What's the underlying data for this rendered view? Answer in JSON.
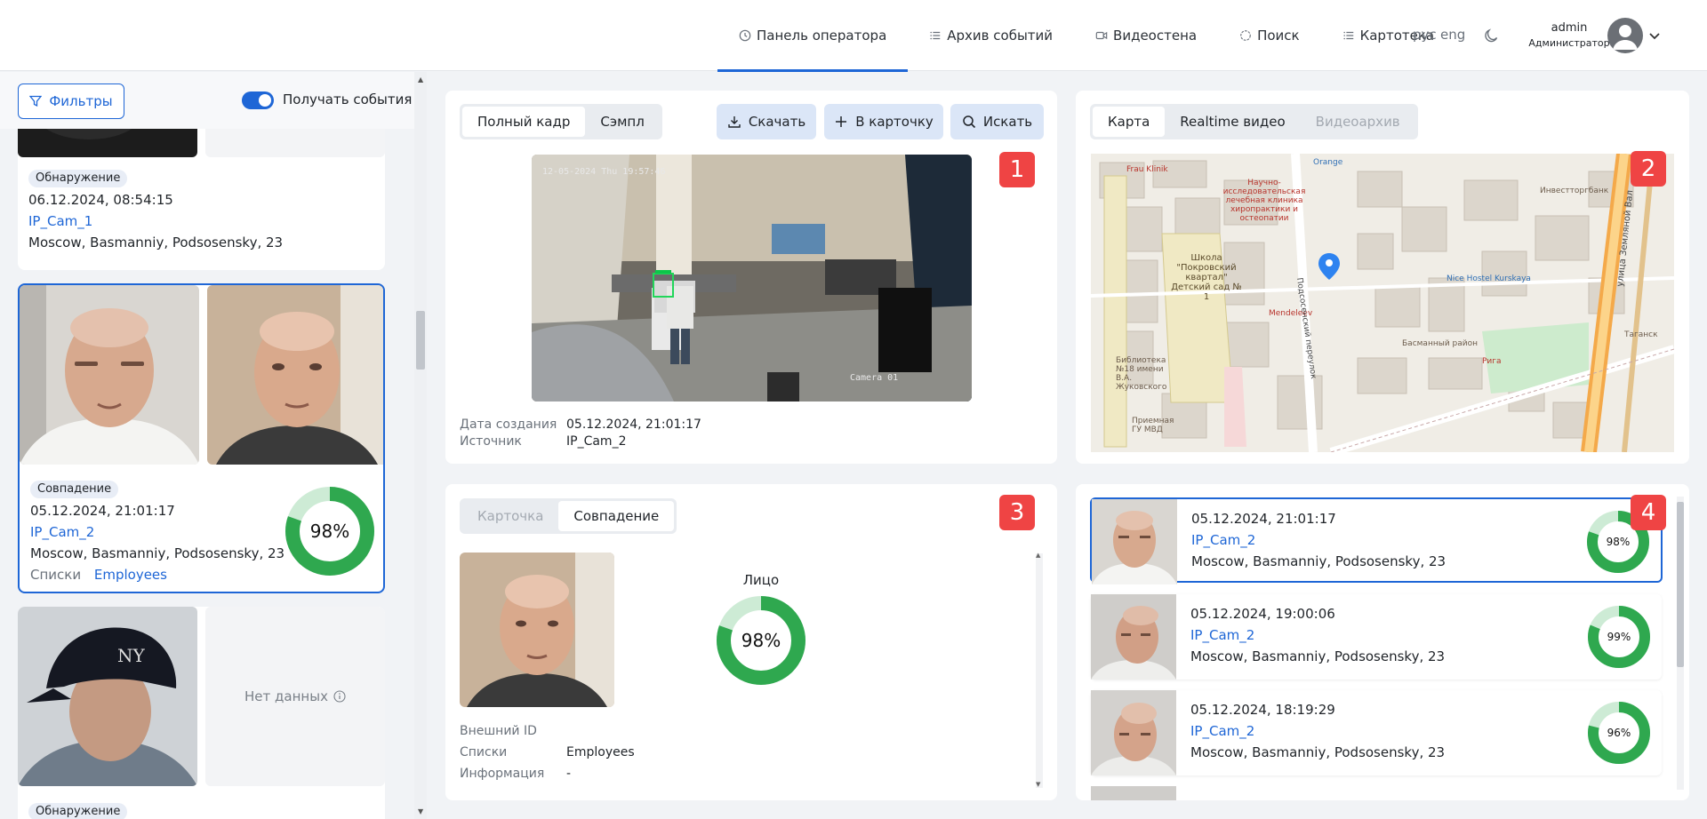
{
  "nav": {
    "items": [
      {
        "label": "Панель оператора",
        "icon": "clock-icon",
        "active": true
      },
      {
        "label": "Архив событий",
        "icon": "list-icon",
        "active": false
      },
      {
        "label": "Видеостена",
        "icon": "video-icon",
        "active": false
      },
      {
        "label": "Поиск",
        "icon": "search-circle-icon",
        "active": false
      },
      {
        "label": "Картотека",
        "icon": "list-icon",
        "active": false
      }
    ],
    "lang_ru": "рус",
    "lang_en": "eng",
    "user_name": "admin",
    "user_role": "Администратор"
  },
  "sidebar": {
    "filters_label": "Фильтры",
    "toggle_label": "Получать события",
    "events": [
      {
        "tag": "Обнаружение",
        "datetime": "06.12.2024, 08:54:15",
        "camera": "IP_Cam_1",
        "location": "Moscow, Basmanniy, Podsosensky, 23"
      },
      {
        "tag": "Совпадение",
        "datetime": "05.12.2024, 21:01:17",
        "camera": "IP_Cam_2",
        "location": "Moscow, Basmanniy, Podsosensky, 23",
        "lists_label": "Списки",
        "lists_value": "Employees",
        "score": "98%",
        "score_value": 98
      },
      {
        "tag": "Обнаружение",
        "nodata": "Нет данных"
      }
    ]
  },
  "frame_panel": {
    "tabs": [
      "Полный кадр",
      "Сэмпл"
    ],
    "download_label": "Скачать",
    "to_card_label": "В карточку",
    "search_label": "Искать",
    "badge": "1",
    "osd_time": "12-05-2024 Thu 19:57:46",
    "osd_camera": "Camera 01",
    "created_label": "Дата создания",
    "created_value": "05.12.2024, 21:01:17",
    "source_label": "Источник",
    "source_value": "IP_Cam_2"
  },
  "map_panel": {
    "tabs": [
      "Карта",
      "Realtime видео",
      "Видеоархив"
    ],
    "badge": "2",
    "labels": {
      "frau": "Frau Klinik",
      "orange": "Orange",
      "clinic": "Научно-исследовательская лечебная клиника хиропрактики и остеопатии",
      "school": "Школа \"Покровский квартал\" Детский сад № 1",
      "street1": "Подсосенский переулок",
      "street2": "улица Земляной Вал",
      "mendeleev": "Mendeleev",
      "nice": "Nice Hostel Kurskaya",
      "bank": "Инвестторгбанк",
      "library": "Библиотека №18 имени В.А. Жуковского",
      "police": "Приемная ГУ МВД",
      "riga": "Рига",
      "basman": "Басманный район",
      "tagan": "Таганск"
    }
  },
  "match_panel": {
    "tabs": [
      "Карточка",
      "Совпадение"
    ],
    "badge": "3",
    "face_label": "Лицо",
    "score": "98%",
    "score_value": 98,
    "ext_id_label": "Внешний ID",
    "lists_label": "Списки",
    "lists_value": "Employees",
    "info_label": "Информация",
    "info_value": "-"
  },
  "matches_list": {
    "badge": "4",
    "rows": [
      {
        "datetime": "05.12.2024, 21:01:17",
        "camera": "IP_Cam_2",
        "location": "Moscow, Basmanniy, Podsosensky, 23",
        "score": "98%",
        "score_value": 98
      },
      {
        "datetime": "05.12.2024, 19:00:06",
        "camera": "IP_Cam_2",
        "location": "Moscow, Basmanniy, Podsosensky, 23",
        "score": "99%",
        "score_value": 99
      },
      {
        "datetime": "05.12.2024, 18:19:29",
        "camera": "IP_Cam_2",
        "location": "Moscow, Basmanniy, Podsosensky, 23",
        "score": "96%",
        "score_value": 96
      }
    ]
  },
  "colors": {
    "accent": "#1e66d6",
    "ring_green": "#2fa84f",
    "badge_red": "#ef4444"
  }
}
